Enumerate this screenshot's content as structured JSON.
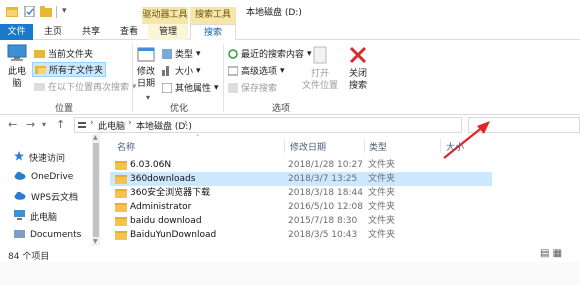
{
  "titlebar": {
    "title": "本地磁盘 (D:)",
    "context_drive_tools": "驱动器工具",
    "context_search_tools": "搜索工具"
  },
  "tabs": {
    "file": "文件",
    "home": "主页",
    "share": "共享",
    "view": "查看",
    "manage": "管理",
    "search": "搜索"
  },
  "ribbon": {
    "location": {
      "this_pc": "此电\n脑",
      "current_folder": "当前文件夹",
      "all_subfolders": "所有子文件夹",
      "search_again": "在以下位置再次搜索",
      "group_label": "位置"
    },
    "refine": {
      "date_modified": "修改\n日期",
      "kind": "类型",
      "size": "大小",
      "other_props": "其他属性",
      "group_label": "优化"
    },
    "options": {
      "recent_searches": "最近的搜索内容",
      "advanced_options": "高级选项",
      "save_search": "保存搜索",
      "open_file_location": "打开\n文件位置",
      "close_search": "关闭\n搜索",
      "group_label": "选项"
    }
  },
  "address": {
    "path": [
      "此电脑",
      "本地磁盘 (D:)"
    ],
    "search_placeholder": ""
  },
  "nav_pane": {
    "items": [
      {
        "label": "快速访问",
        "icon": "star-icon"
      },
      {
        "label": "OneDrive",
        "icon": "cloud-icon"
      },
      {
        "label": "WPS云文档",
        "icon": "cloud-icon"
      },
      {
        "label": "此电脑",
        "icon": "computer-icon"
      },
      {
        "label": "Documents",
        "icon": "folder-icon"
      }
    ]
  },
  "columns": {
    "name": "名称",
    "date": "修改日期",
    "type": "类型",
    "size": "大小"
  },
  "files": [
    {
      "name": "6.03.06N",
      "date": "2018/1/28 10:27",
      "type": "文件夹"
    },
    {
      "name": "360downloads",
      "date": "2018/3/7 13:25",
      "type": "文件夹"
    },
    {
      "name": "360安全浏览器下载",
      "date": "2018/3/18 18:44",
      "type": "文件夹"
    },
    {
      "name": "Administrator",
      "date": "2016/5/10 12:08",
      "type": "文件夹"
    },
    {
      "name": "baidu download",
      "date": "2015/7/18 8:30",
      "type": "文件夹"
    },
    {
      "name": "BaiduYunDownload",
      "date": "2018/3/5 10:43",
      "type": "文件夹"
    }
  ],
  "selected_row": 1,
  "status": {
    "count": "84 个项目"
  },
  "colors": {
    "file_tab": "#1979ca",
    "context_tab": "#f6e7a8",
    "selection": "#cce8ff",
    "annotation_arrow": "#e0262b"
  }
}
